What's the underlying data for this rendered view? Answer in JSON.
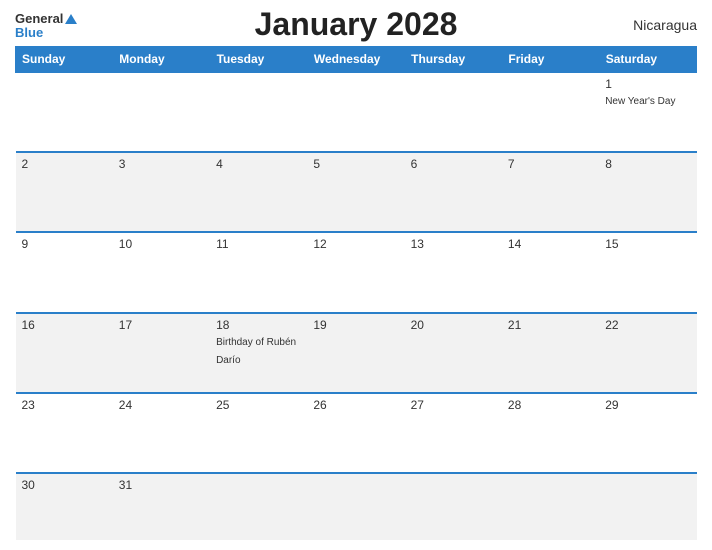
{
  "header": {
    "logo_general": "General",
    "logo_blue": "Blue",
    "title": "January 2028",
    "country": "Nicaragua"
  },
  "weekdays": [
    "Sunday",
    "Monday",
    "Tuesday",
    "Wednesday",
    "Thursday",
    "Friday",
    "Saturday"
  ],
  "weeks": [
    [
      {
        "day": "",
        "event": ""
      },
      {
        "day": "",
        "event": ""
      },
      {
        "day": "",
        "event": ""
      },
      {
        "day": "",
        "event": ""
      },
      {
        "day": "",
        "event": ""
      },
      {
        "day": "",
        "event": ""
      },
      {
        "day": "1",
        "event": "New Year's Day"
      }
    ],
    [
      {
        "day": "2",
        "event": ""
      },
      {
        "day": "3",
        "event": ""
      },
      {
        "day": "4",
        "event": ""
      },
      {
        "day": "5",
        "event": ""
      },
      {
        "day": "6",
        "event": ""
      },
      {
        "day": "7",
        "event": ""
      },
      {
        "day": "8",
        "event": ""
      }
    ],
    [
      {
        "day": "9",
        "event": ""
      },
      {
        "day": "10",
        "event": ""
      },
      {
        "day": "11",
        "event": ""
      },
      {
        "day": "12",
        "event": ""
      },
      {
        "day": "13",
        "event": ""
      },
      {
        "day": "14",
        "event": ""
      },
      {
        "day": "15",
        "event": ""
      }
    ],
    [
      {
        "day": "16",
        "event": ""
      },
      {
        "day": "17",
        "event": ""
      },
      {
        "day": "18",
        "event": "Birthday of Rubén Darío"
      },
      {
        "day": "19",
        "event": ""
      },
      {
        "day": "20",
        "event": ""
      },
      {
        "day": "21",
        "event": ""
      },
      {
        "day": "22",
        "event": ""
      }
    ],
    [
      {
        "day": "23",
        "event": ""
      },
      {
        "day": "24",
        "event": ""
      },
      {
        "day": "25",
        "event": ""
      },
      {
        "day": "26",
        "event": ""
      },
      {
        "day": "27",
        "event": ""
      },
      {
        "day": "28",
        "event": ""
      },
      {
        "day": "29",
        "event": ""
      }
    ],
    [
      {
        "day": "30",
        "event": ""
      },
      {
        "day": "31",
        "event": ""
      },
      {
        "day": "",
        "event": ""
      },
      {
        "day": "",
        "event": ""
      },
      {
        "day": "",
        "event": ""
      },
      {
        "day": "",
        "event": ""
      },
      {
        "day": "",
        "event": ""
      }
    ]
  ]
}
